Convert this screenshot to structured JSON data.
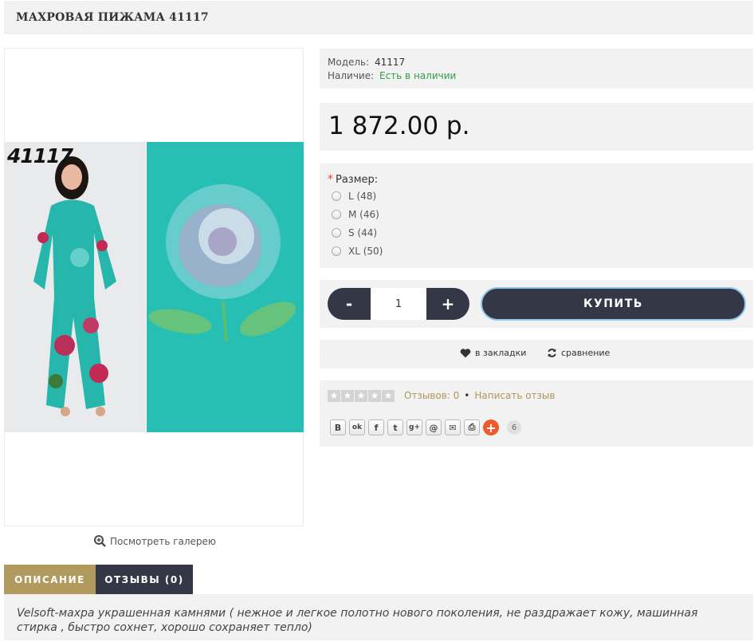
{
  "page_title": "МАХРОВАЯ ПИЖАМА 41117",
  "image": {
    "code": "41117",
    "gallery_link": "Посмотреть галерею"
  },
  "info": {
    "model_label": "Модель:",
    "model_value": "41117",
    "availability_label": "Наличие:",
    "availability_value": "Есть в наличии"
  },
  "price": "1 872.00 р.",
  "options": {
    "label": "Размер:",
    "required_mark": "*",
    "items": [
      "L (48)",
      "M (46)",
      "S (44)",
      "XL (50)"
    ]
  },
  "cart": {
    "minus": "-",
    "quantity": "1",
    "plus": "+",
    "buy_label": "КУПИТЬ"
  },
  "actions": {
    "bookmarks": "в закладки",
    "compare": "сравнение"
  },
  "reviews": {
    "rating": 0,
    "count_text": "Отзывов: 0",
    "separator": "•",
    "write_review": "Написать отзыв"
  },
  "share": {
    "icons": [
      "vk-icon",
      "odnoklassniki-icon",
      "facebook-icon",
      "twitter-icon",
      "google-plus-icon",
      "mail-at-icon",
      "email-icon",
      "print-icon"
    ],
    "glyphs": [
      "B",
      "ok",
      "f",
      "t",
      "g+",
      "@",
      "✉",
      "⎙"
    ],
    "count": "6"
  },
  "tabs": {
    "description": "ОПИСАНИЕ",
    "reviews": "ОТЗЫВЫ (0)"
  },
  "description": "Velsoft-махра украшенная камнями ( нежное и легкое полотно нового поколения, не раздражает кожу, машинная стирка , быстро сохнет, хорошо сохраняет тепло)",
  "colors": {
    "dark_button": "#343746",
    "gold_accent": "#b09a5d",
    "available_green": "#2e9e4a",
    "panel_bg": "#f2f2f2",
    "share_orange": "#ef5a2a"
  }
}
